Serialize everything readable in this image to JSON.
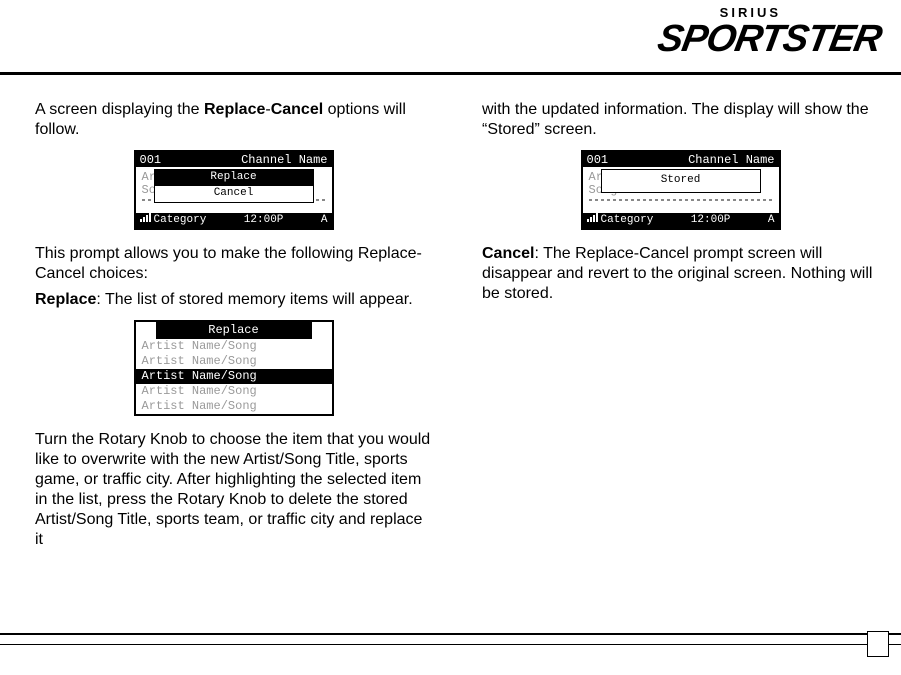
{
  "logo": {
    "brand": "SIRIUS",
    "product": "SPORTSTER"
  },
  "col1": {
    "intro_pre": "A screen displaying the ",
    "intro_b1": "Replace",
    "intro_mid": "-",
    "intro_b2": "Cancel",
    "intro_post": " options will follow.",
    "lcd1": {
      "ch": "001",
      "chname": "Channel Name",
      "bg1": "Artist Name",
      "bg2": "Song Title",
      "opt1": "Replace",
      "opt2": "Cancel",
      "cat": "Category",
      "time": "12:00P",
      "bank": "A"
    },
    "p2": "This prompt allows you to make the following Replace-Cancel choices:",
    "p3_b": "Replace",
    "p3_rest": ": The list of stored memory items will appear.",
    "lcd2": {
      "title": "Replace",
      "rows": [
        "Artist Name/Song",
        "Artist Name/Song",
        "Artist Name/Song",
        "Artist Name/Song",
        "Artist Name/Song"
      ]
    },
    "p4": "Turn the Rotary Knob to choose the item that you would like to overwrite with the new Artist/Song Title,  sports game, or traffic city. After highlighting the selected item in the list, press the Rotary Knob to delete the stored Artist/Song Title, sports team, or traffic city and replace it"
  },
  "col2": {
    "p1": "with the updated information. The display will show the “Stored” screen.",
    "lcd3": {
      "ch": "001",
      "chname": "Channel Name",
      "bg1": "Artist Name",
      "bg2": "Song Title",
      "msg": "Stored",
      "cat": "Category",
      "time": "12:00P",
      "bank": "A"
    },
    "p2_b": "Cancel",
    "p2_rest": ": The Replace-Cancel prompt screen will disappear and revert to the original screen. Nothing will be stored."
  }
}
